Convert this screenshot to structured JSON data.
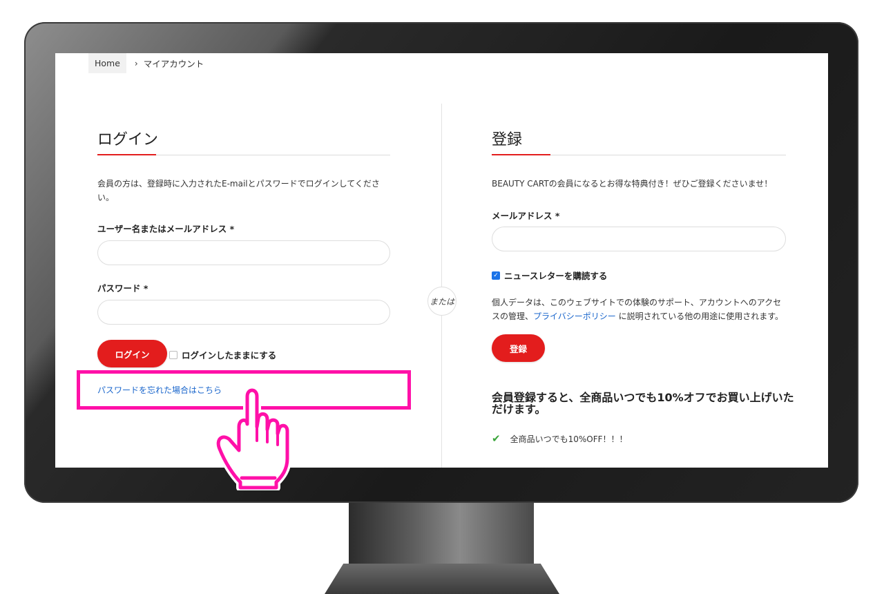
{
  "breadcrumb": {
    "home": "Home",
    "separator": "›",
    "current": "マイアカウント"
  },
  "login": {
    "title": "ログイン",
    "description": "会員の方は、登録時に入力されたE-mailとパスワードでログインしてください。",
    "username_label": "ユーザー名またはメールアドレス *",
    "username_value": "",
    "password_label": "パスワード *",
    "password_value": "",
    "submit_label": "ログイン",
    "remember_label": "ログインしたままにする",
    "remember_checked": false,
    "forgot_link": "パスワードを忘れた場合はこちら"
  },
  "divider": {
    "or_label": "または"
  },
  "register": {
    "title": "登録",
    "description": "BEAUTY CARTの会員になるとお得な特典付き！ぜひご登録くださいませ！",
    "email_label": "メールアドレス *",
    "email_value": "",
    "newsletter_label": "ニュースレターを購読する",
    "newsletter_checked": true,
    "privacy_text_before": "個人データは、このウェブサイトでの体験のサポート、アカウントへのアクセスの管理、",
    "privacy_link": "プライバシーポリシー",
    "privacy_text_after": " に説明されている他の用途に使用されます。",
    "submit_label": "登録",
    "benefit_title": "会員登録すると、全商品いつでも10%オフでお買い上げいただけます。",
    "benefit_item": "全商品いつでも10%OFF！！！"
  },
  "icons": {
    "breadcrumb_separator": "chevron-right-icon",
    "benefit_check": "checkmark-icon",
    "pointer": "hand-pointer-icon"
  },
  "colors": {
    "accent_red": "#e31d1d",
    "link_blue": "#1a66cc",
    "highlight_pink": "#ff10a8",
    "check_green": "#3aa53a"
  }
}
